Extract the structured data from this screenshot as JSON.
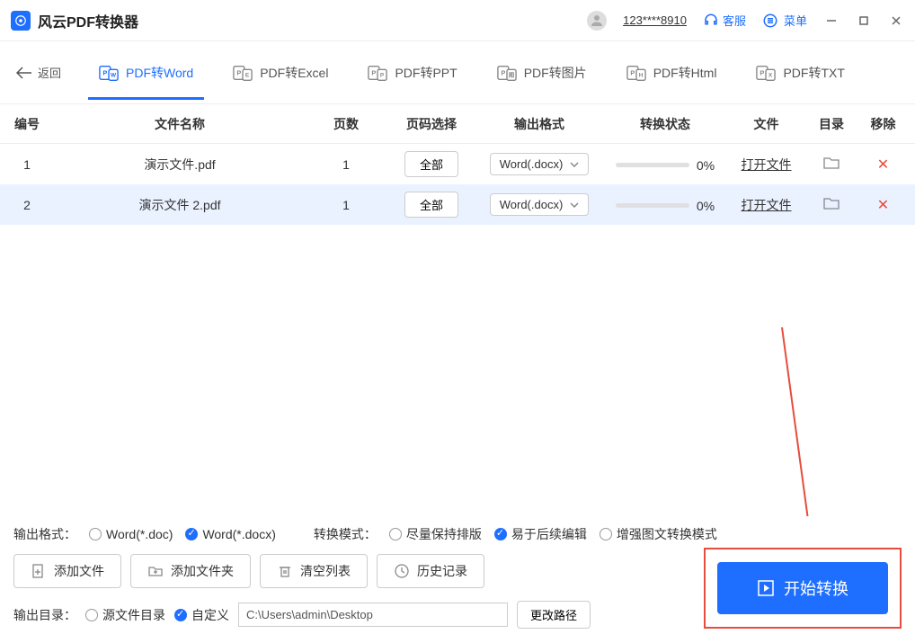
{
  "titlebar": {
    "app_title": "风云PDF转换器",
    "user_id": "123****8910",
    "support": "客服",
    "menu": "菜单"
  },
  "back_label": "返回",
  "tabs": [
    {
      "label": "PDF转Word",
      "active": true
    },
    {
      "label": "PDF转Excel",
      "active": false
    },
    {
      "label": "PDF转PPT",
      "active": false
    },
    {
      "label": "PDF转图片",
      "active": false
    },
    {
      "label": "PDF转Html",
      "active": false
    },
    {
      "label": "PDF转TXT",
      "active": false
    }
  ],
  "columns": {
    "idx": "编号",
    "name": "文件名称",
    "pages": "页数",
    "pagesel": "页码选择",
    "format": "输出格式",
    "status": "转换状态",
    "file": "文件",
    "dir": "目录",
    "del": "移除"
  },
  "rows": [
    {
      "idx": "1",
      "name": "演示文件.pdf",
      "pages": "1",
      "pagesel": "全部",
      "format": "Word(.docx)",
      "progress": "0%",
      "open": "打开文件"
    },
    {
      "idx": "2",
      "name": "演示文件 2.pdf",
      "pages": "1",
      "pagesel": "全部",
      "format": "Word(.docx)",
      "progress": "0%",
      "open": "打开文件"
    }
  ],
  "output_format": {
    "label": "输出格式：",
    "opt_doc": "Word(*.doc)",
    "opt_docx": "Word(*.docx)"
  },
  "convert_mode": {
    "label": "转换模式：",
    "opt_keep": "尽量保持排版",
    "opt_edit": "易于后续编辑",
    "opt_enhance": "增强图文转换模式"
  },
  "actions": {
    "add_file": "添加文件",
    "add_folder": "添加文件夹",
    "clear": "清空列表",
    "history": "历史记录"
  },
  "output_dir": {
    "label": "输出目录：",
    "opt_source": "源文件目录",
    "opt_custom": "自定义",
    "path": "C:\\Users\\admin\\Desktop",
    "change": "更改路径"
  },
  "start": "开始转换"
}
